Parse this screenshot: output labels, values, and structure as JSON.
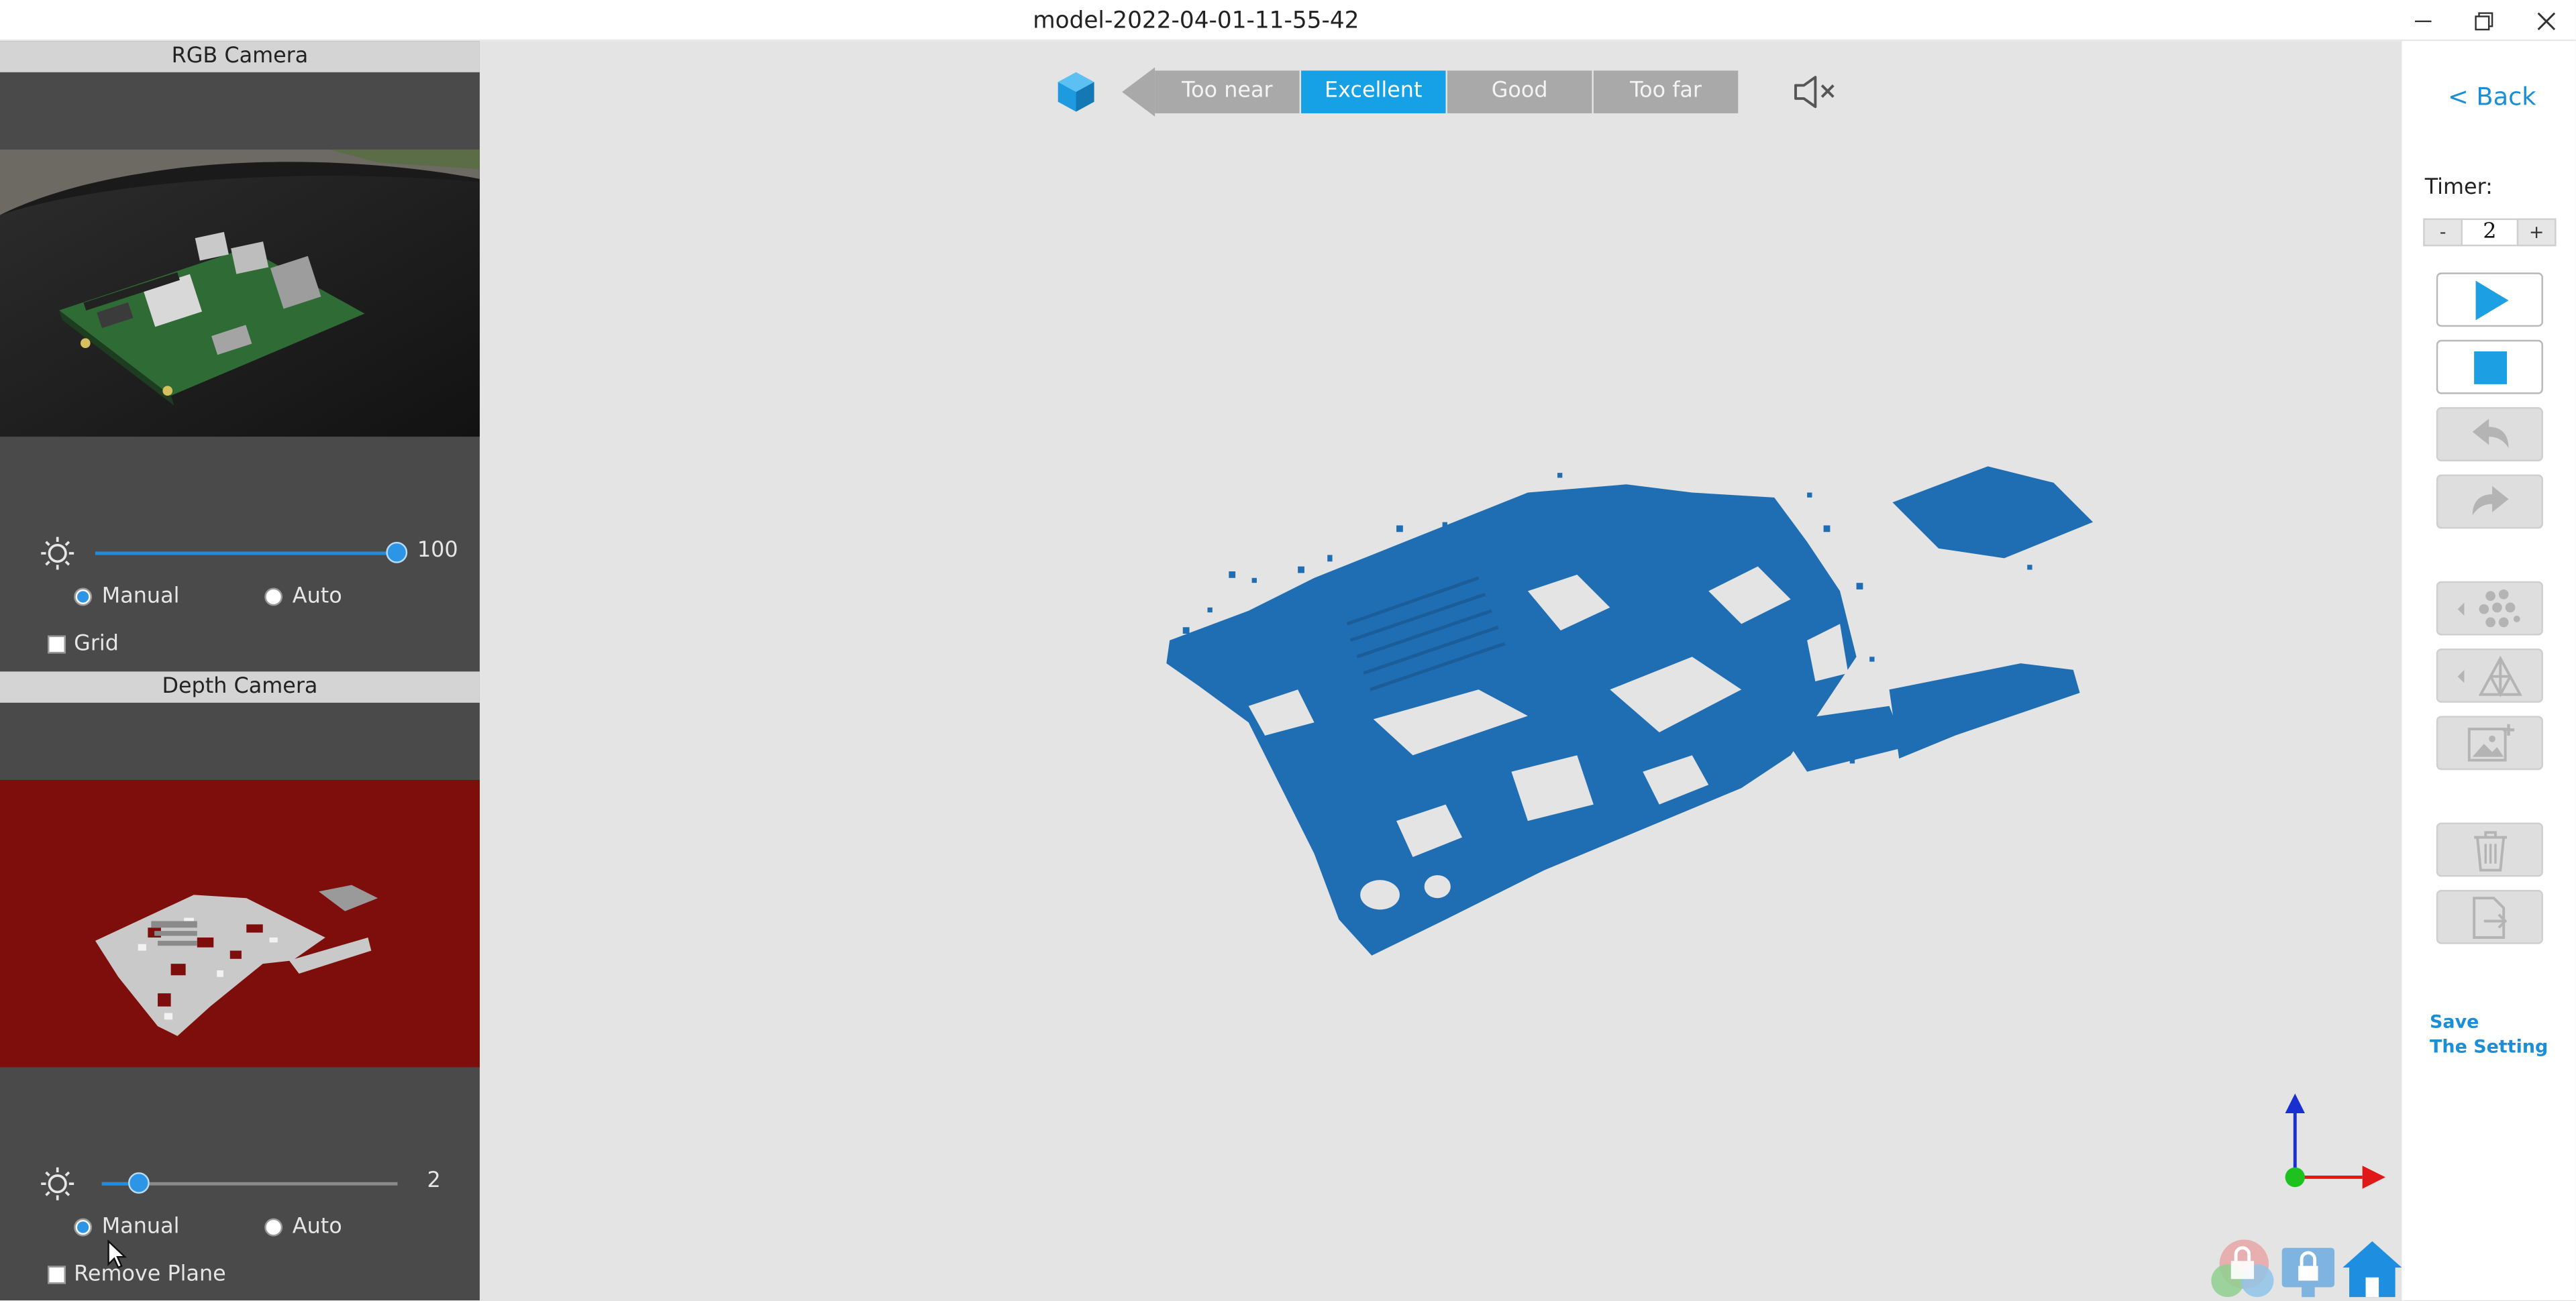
{
  "window": {
    "title": "model-2022-04-01-11-55-42"
  },
  "rgb_camera": {
    "header": "RGB Camera",
    "brightness_value": "100",
    "brightness_level": 1.0,
    "manual_label": "Manual",
    "auto_label": "Auto",
    "selected_mode": "Manual",
    "grid_label": "Grid",
    "grid_checked": false
  },
  "depth_camera": {
    "header": "Depth Camera",
    "exposure_value": "2",
    "exposure_level": 0.12,
    "manual_label": "Manual",
    "auto_label": "Auto",
    "selected_mode": "Manual",
    "remove_plane_label": "Remove Plane",
    "remove_plane_checked": false
  },
  "distance": {
    "segments": [
      "Too near",
      "Excellent",
      "Good",
      "Too far"
    ],
    "active": "Excellent"
  },
  "sidebar": {
    "back_label": "< Back",
    "timer_label": "Timer:",
    "timer_minus": "-",
    "timer_value": "2",
    "timer_plus": "+",
    "save_line1": "Save",
    "save_line2": "The Setting"
  },
  "colors": {
    "accent": "#16a0e6",
    "scan_mesh": "#1f6eb4",
    "depth_background": "#7e0e0c",
    "panel": "#4a4a4a",
    "viewport": "#e4e4e4"
  },
  "icons": {
    "toolbar": [
      "play-icon",
      "stop-icon",
      "undo-icon",
      "redo-icon",
      "point-cloud-icon",
      "mesh-icon",
      "add-texture-icon",
      "delete-icon",
      "export-icon"
    ],
    "bottom": [
      "lock-icon",
      "screen-lock-icon",
      "home-icon"
    ]
  }
}
